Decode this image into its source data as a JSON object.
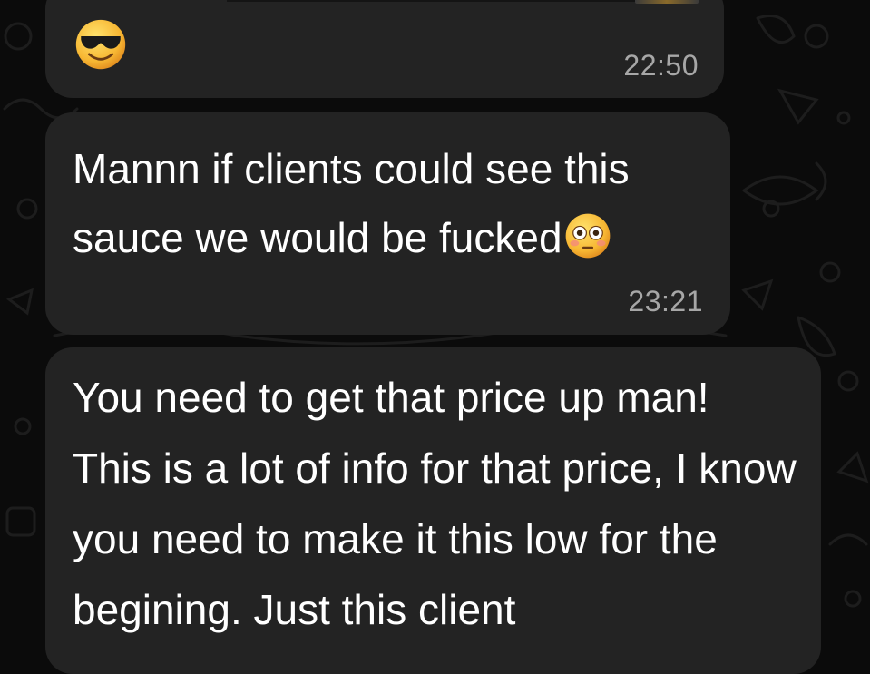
{
  "messages": [
    {
      "id": "msg-1",
      "emoji": "smiling-face-with-sunglasses-icon",
      "time": "22:50"
    },
    {
      "id": "msg-2",
      "text": "Mannn if clients could see this sauce we would be fucked",
      "emoji": "flushed-face-icon",
      "time": "23:21"
    },
    {
      "id": "msg-3",
      "text": "You need to get that price up man! This is a lot of info for that price, I know you need to make it this low for the begining. Just this client"
    }
  ],
  "colors": {
    "background": "#0b0b0b",
    "bubble": "#232323",
    "text": "#ffffff",
    "timestamp": "#a7a7a7",
    "doodle": "#1c1c1c"
  }
}
